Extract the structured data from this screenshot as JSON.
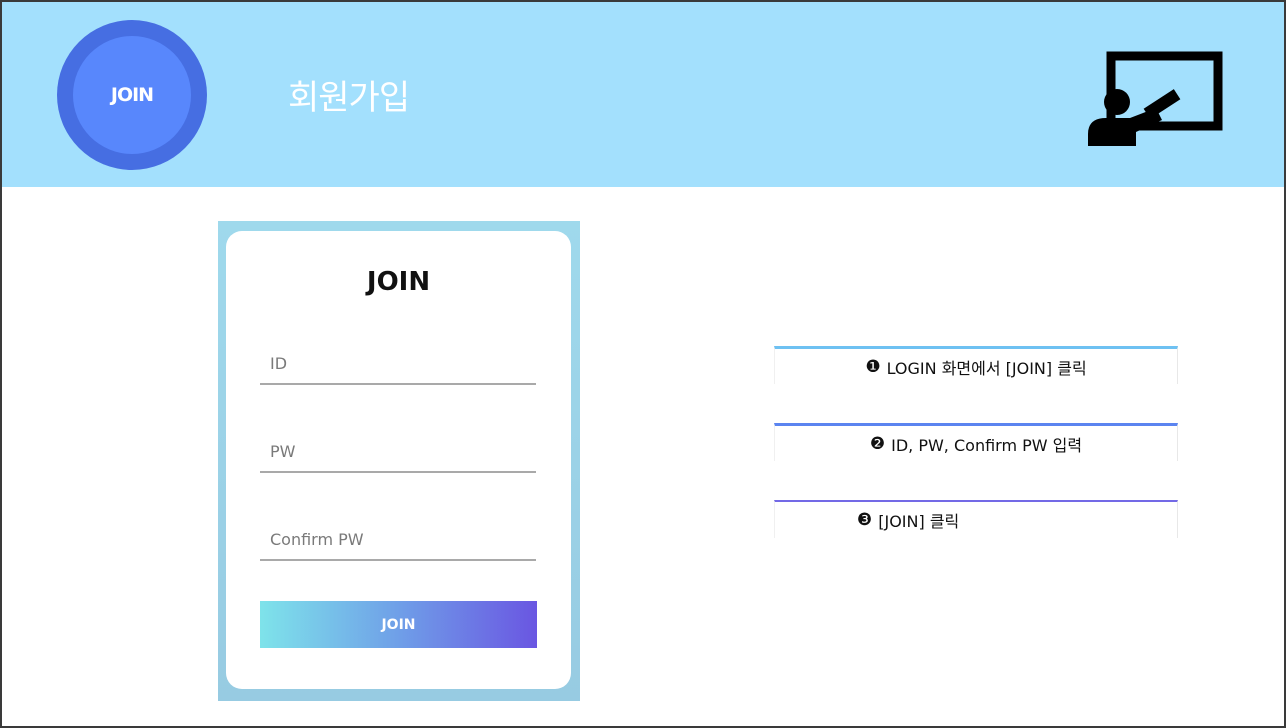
{
  "header": {
    "logo_label": "JOIN",
    "page_title": "회원가입",
    "presenter_icon": "presenter-teaching-icon"
  },
  "form": {
    "title": "JOIN",
    "id_placeholder": "ID",
    "pw_placeholder": "PW",
    "confirm_placeholder": "Confirm PW",
    "submit_label": "JOIN"
  },
  "steps": [
    {
      "num": "❶",
      "text": "LOGIN 화면에서 [JOIN] 클릭"
    },
    {
      "num": "❷",
      "text": "ID, PW, Confirm PW 입력"
    },
    {
      "num": "❸",
      "text": "[JOIN] 클릭"
    }
  ],
  "colors": {
    "header_bg": "#a3e0fd",
    "logo_outer": "#466ee2",
    "logo_inner": "#5887fc",
    "step1_accent": "#6ec1f2",
    "step2_accent": "#5b84f0",
    "step3_accent": "#7369e6"
  }
}
